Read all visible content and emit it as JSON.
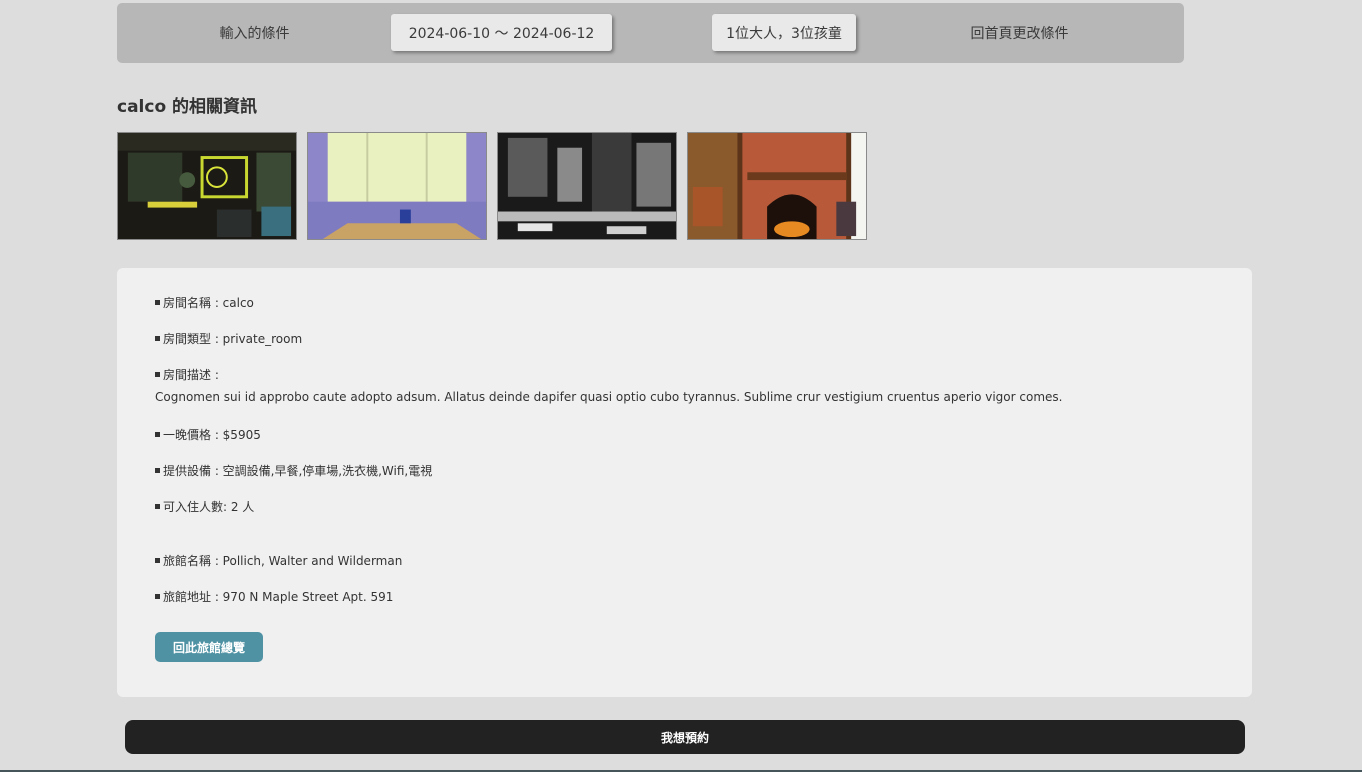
{
  "search_conditions": {
    "label": "輸入的條件",
    "date_range": "2024-06-10 ～ 2024-06-12",
    "guests": "1位大人，3位孩童",
    "back_home_label": "回首頁更改條件"
  },
  "room": {
    "heading": "calco 的相關資訊",
    "details": {
      "name": "房間名稱 : calco",
      "type": "房間類型 : private_room",
      "description_label": "房間描述 :",
      "description": "Cognomen sui id approbo caute adopto adsum. Allatus deinde dapifer quasi optio cubo tyrannus. Sublime crur vestigium cruentus aperio vigor comes.",
      "price": "一晚價格 : $5905",
      "amenities": "提供設備 : 空調設備,早餐,停車場,洗衣機,Wifi,電視",
      "capacity": "可入住人數: 2 人",
      "hotel_name": "旅館名稱 : Pollich, Walter and Wilderman",
      "hotel_address": "旅館地址 : 970 N Maple Street Apt. 591"
    },
    "photos": [
      {
        "icon": "cafe-storefront-photo"
      },
      {
        "icon": "window-table-mug-photo"
      },
      {
        "icon": "monochrome-interior-photo"
      },
      {
        "icon": "brick-fireplace-room-photo"
      }
    ]
  },
  "buttons": {
    "back_to_hotel": "回此旅館總覽",
    "book": "我想預約"
  },
  "colors": {
    "page_bg": "#dddddd",
    "condition_bar": "#b7b7b7",
    "accent_button": "#4f92a4",
    "book_button": "#222222"
  }
}
